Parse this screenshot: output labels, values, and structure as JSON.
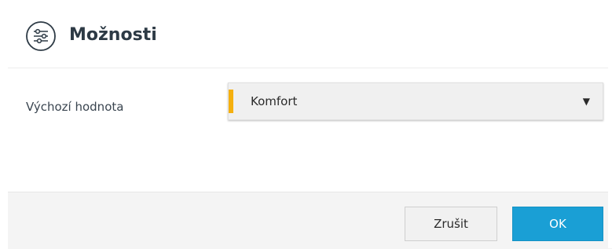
{
  "dialog": {
    "title": "Možnosti",
    "icon": "sliders-icon"
  },
  "field": {
    "label": "Výchozí hodnota",
    "select_value": "Komfort",
    "caret": "▼"
  },
  "footer": {
    "cancel_label": "Zrušit",
    "ok_label": "OK"
  },
  "colors": {
    "accent": "#f5b00f",
    "primary_button": "#1a9fd5"
  }
}
